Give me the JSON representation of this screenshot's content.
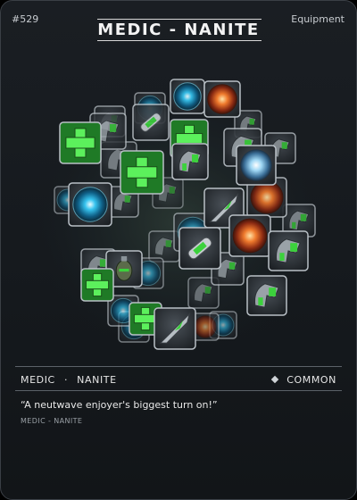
{
  "card": {
    "number": "#529",
    "type": "Equipment",
    "title": "MEDIC - NANITE",
    "category": "MEDIC",
    "separator": "·",
    "subcategory": "NANITE",
    "rarity": "COMMON",
    "flavor_text": "“A neutwave enjoyer's biggest turn on!”",
    "subtitle": "MEDIC - NANITE"
  },
  "icons": {
    "rarity": "diamond-icon",
    "items": [
      "medkit-cross-icon",
      "nanite-orb-icon",
      "fire-orb-icon",
      "stim-injector-icon",
      "bio-claw-icon",
      "grenade-icon",
      "dart-icon",
      "crystal-orb-icon",
      "armor-helmet-icon"
    ]
  },
  "colors": {
    "accent_green": "#3cd23c",
    "accent_blue": "#2fb8e6",
    "accent_orange": "#e2682a",
    "card_bg": "#15191d"
  }
}
